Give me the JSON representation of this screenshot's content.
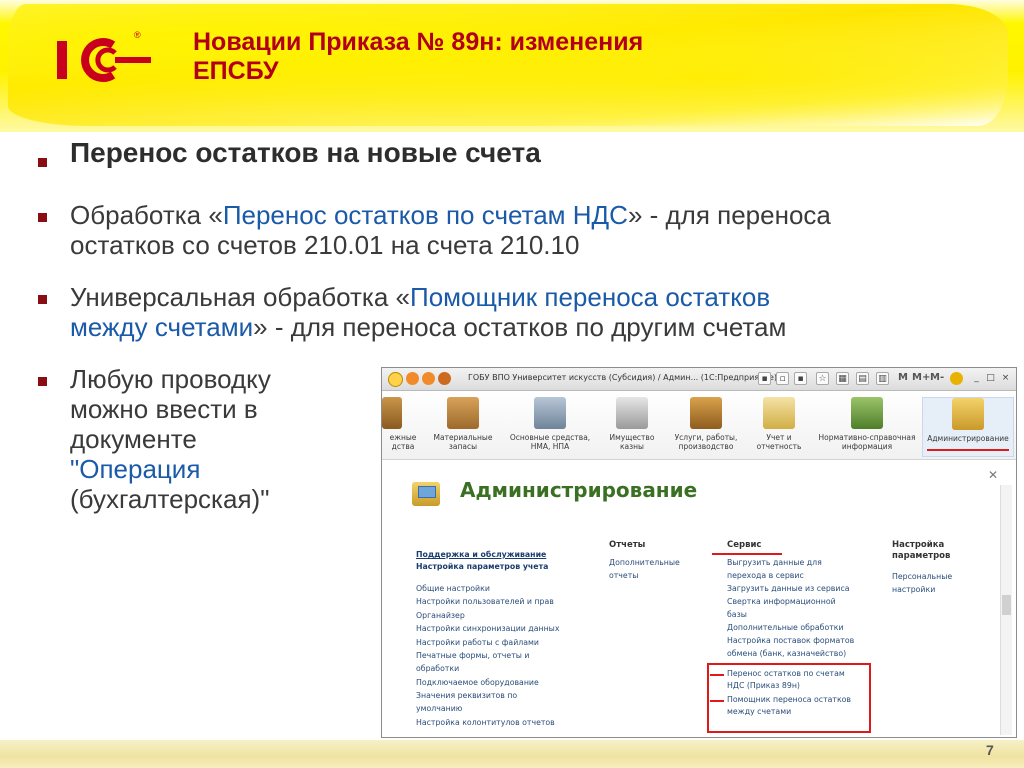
{
  "header": {
    "title_line1": "Новации Приказа № 89н: изменения",
    "title_line2": "ЕПСБУ",
    "logo_text": "1С",
    "logo_reg": "®"
  },
  "bullets": {
    "b1": "Перенос остатков на новые счета",
    "b2": {
      "pre": "Обработка «",
      "link": "Перенос остатков по счетам НДС",
      "post1": "» - для переноса",
      "line2": "остатков со счетов 210.01 на счета 210.10"
    },
    "b3": {
      "pre": "Универсальная обработка «",
      "link1": "Помощник переноса остатков",
      "link2": "между счетами",
      "post": "» - для переноса остатков по другим счетам"
    },
    "b4": {
      "l1": "Любую проводку",
      "l2": "можно ввести в",
      "l3": "документе",
      "l4": "\"Операция",
      "l5": "(бухгалтерская)\""
    }
  },
  "screenshot": {
    "window_title": "ГОБУ ВПО Университет искусств (Субсидия) / Админ...   (1С:Предприятие)",
    "tb_letters": [
      "M",
      "M+",
      "M-"
    ],
    "toolbar": [
      {
        "line1": "ежные",
        "line2": "дства"
      },
      {
        "line1": "Материальные",
        "line2": "запасы"
      },
      {
        "line1": "Основные средства,",
        "line2": "НМА, НПА"
      },
      {
        "line1": "Имущество",
        "line2": "казны"
      },
      {
        "line1": "Услуги, работы,",
        "line2": "производство"
      },
      {
        "line1": "Учет и",
        "line2": "отчетность"
      },
      {
        "line1": "Нормативно-справочная",
        "line2": "информация"
      },
      {
        "line1": "Администрирование",
        "line2": ""
      }
    ],
    "section_title": "Администрирование",
    "left_col": {
      "head1": "Поддержка и обслуживание",
      "head2": "Настройка параметров учета",
      "items": [
        "Общие настройки",
        "Настройки пользователей и прав",
        "Органайзер",
        "Настройки синхронизации данных",
        "Настройки работы с файлами",
        "Печатные формы, отчеты и",
        "обработки",
        "Подключаемое оборудование",
        "Значения реквизитов по",
        "умолчанию",
        "Настройка колонтитулов отчетов"
      ]
    },
    "reports_col": {
      "head": "Отчеты",
      "items": [
        "Дополнительные",
        "отчеты"
      ]
    },
    "service_col": {
      "head": "Сервис",
      "items": [
        "Выгрузить данные для",
        "перехода в сервис",
        "Загрузить данные из сервиса",
        "Свертка информационной",
        "базы",
        "Дополнительные обработки",
        "Настройка поставок форматов",
        "обмена (банк, казначейство)"
      ],
      "highlight": [
        "Перенос остатков по счетам",
        "НДС (Приказ 89н)",
        "Помощник переноса остатков",
        "между счетами"
      ]
    },
    "settings_col": {
      "head1": "Настройка",
      "head2": "параметров",
      "items": [
        "Персональные",
        "настройки"
      ]
    }
  },
  "footer": {
    "page": "7"
  },
  "colors": {
    "title": "#b3001a",
    "link": "#1a5aa8",
    "bullet": "#8a0d13",
    "highlight": "#e01a1a",
    "admin_title": "#3b6f23"
  }
}
